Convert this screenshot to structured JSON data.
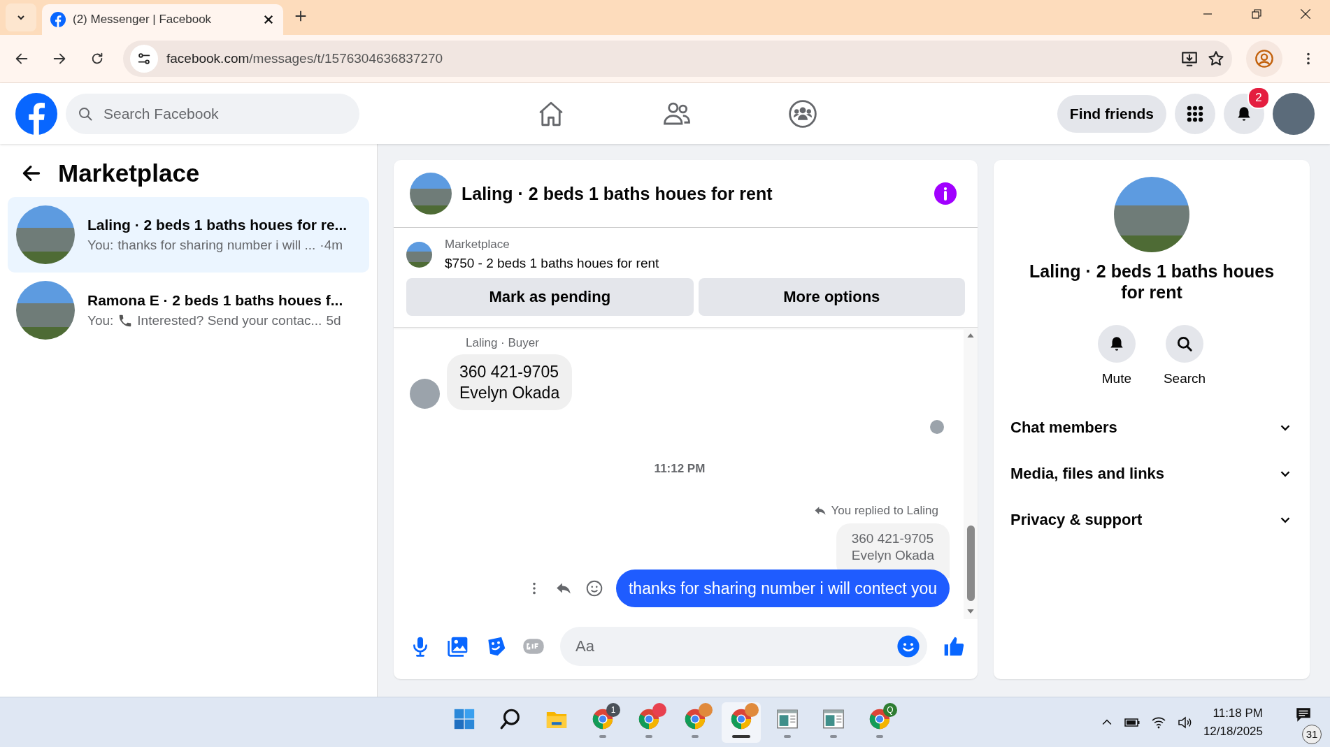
{
  "browser": {
    "tab_title": "(2) Messenger | Facebook",
    "url_domain": "facebook.com",
    "url_path": "/messages/t/1576304636837270"
  },
  "header": {
    "search_placeholder": "Search Facebook",
    "nav": [
      {
        "kind": "home"
      },
      {
        "kind": "friends"
      },
      {
        "kind": "groups"
      }
    ],
    "find_friends": "Find friends",
    "notification_count": "2"
  },
  "sidebar": {
    "title": "Marketplace",
    "chats": [
      {
        "title": "Laling · 2 beds 1 baths houes for re...",
        "prefix": "You:",
        "call_icon": false,
        "preview": "thanks for sharing number i will ...",
        "time": "·4m",
        "selected": true
      },
      {
        "title": "Ramona E · 2 beds 1 baths houes f...",
        "prefix": "You:",
        "call_icon": true,
        "preview": "Interested? Send your contac...",
        "time": "5d",
        "selected": false
      }
    ]
  },
  "conversation": {
    "title": "Laling · 2 beds 1 baths houes for rent",
    "listing": {
      "label": "Marketplace",
      "text": "$750 - 2 beds 1 baths houes for rent"
    },
    "actions": [
      "Mark as pending",
      "More options"
    ],
    "messages": [
      {
        "kind": "incoming",
        "sender": "Laling · Buyer",
        "lines": [
          "360 421-9705",
          "Evelyn Okada"
        ]
      },
      {
        "kind": "seen"
      },
      {
        "kind": "timestamp",
        "text": "11:12 PM"
      },
      {
        "kind": "reply",
        "note": "You replied to Laling",
        "quoted": [
          "360 421-9705",
          "Evelyn Okada"
        ],
        "text": "thanks for sharing number i will contect you"
      }
    ],
    "composer_placeholder": "Aa"
  },
  "details": {
    "title": "Laling · 2 beds 1 baths houes for rent",
    "actions": [
      {
        "kind": "bell",
        "label": "Mute"
      },
      {
        "kind": "search",
        "label": "Search"
      }
    ],
    "sections": [
      {
        "label": "Chat members",
        "expanded": false
      },
      {
        "label": "Media, files and links",
        "expanded": false
      },
      {
        "label": "Privacy & support",
        "expanded": false
      }
    ]
  },
  "taskbar": {
    "apps": [
      {
        "kind": "start",
        "running": false,
        "selected": false
      },
      {
        "kind": "search",
        "running": false,
        "selected": false
      },
      {
        "kind": "files",
        "running": false,
        "selected": false
      },
      {
        "kind": "chrome",
        "badge": "1",
        "color": "#4a5159",
        "running": true,
        "selected": false
      },
      {
        "kind": "chrome",
        "color": "#e8414f",
        "running": true,
        "selected": false
      },
      {
        "kind": "chrome",
        "color": "#e08a3c",
        "running": true,
        "selected": false
      },
      {
        "kind": "chrome",
        "color": "#e08a3c",
        "running": true,
        "selected": true
      },
      {
        "kind": "window",
        "running": true,
        "selected": false
      },
      {
        "kind": "window",
        "running": true,
        "selected": false
      },
      {
        "kind": "chrome",
        "badge": "Q",
        "color": "#2e7d32",
        "running": true,
        "selected": false
      }
    ],
    "time": "11:18 PM",
    "date": "12/18/2025",
    "notifications": "31"
  }
}
